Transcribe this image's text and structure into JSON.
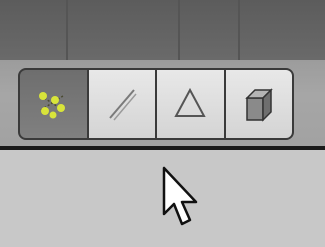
{
  "toolbar": {
    "modes": [
      {
        "id": "vertex",
        "icon": "vertex-select-icon",
        "active": true
      },
      {
        "id": "edge",
        "icon": "edge-select-icon",
        "active": false
      },
      {
        "id": "face",
        "icon": "face-select-icon",
        "active": false
      },
      {
        "id": "occlude",
        "icon": "occlude-geometry-cube-icon",
        "active": false
      }
    ]
  },
  "colors": {
    "active_button": "#757575",
    "inactive_button": "#dcdcdc",
    "vertex_dot": "#d8e43a",
    "separator": "#1a1a1a",
    "bottom_area": "#c8c8c8"
  }
}
